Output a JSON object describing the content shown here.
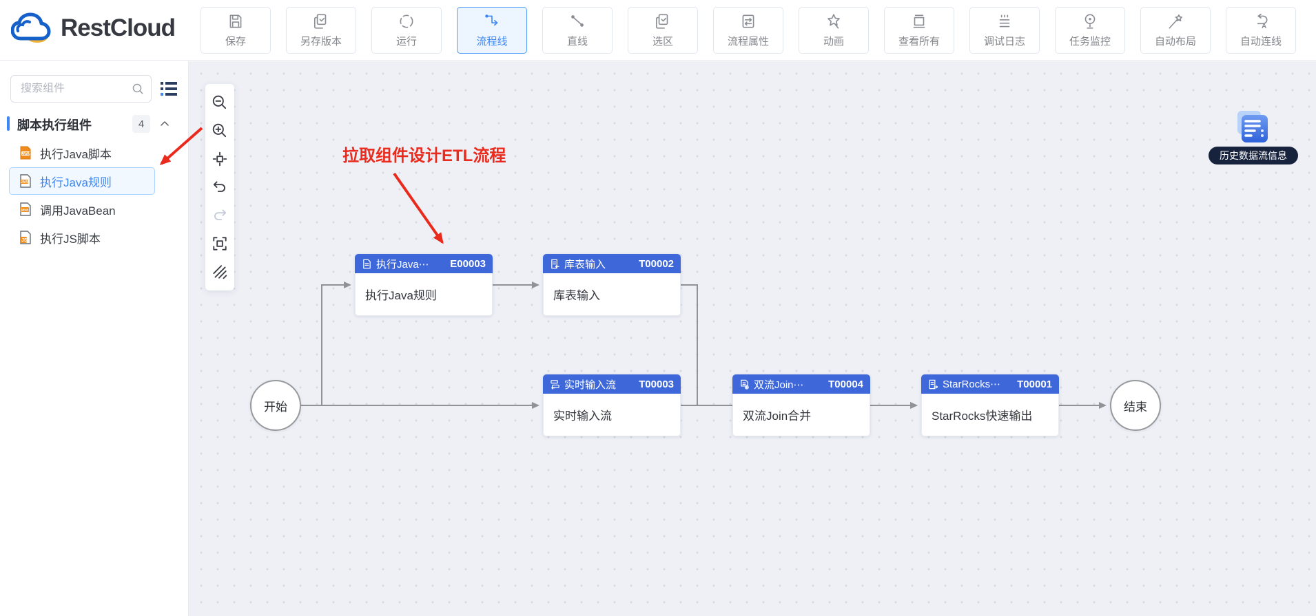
{
  "brand": {
    "name": "RestCloud"
  },
  "toolbar": {
    "buttons": [
      {
        "label": "保存",
        "icon": "save-icon",
        "active": false
      },
      {
        "label": "另存版本",
        "icon": "save-as-version-icon",
        "active": false
      },
      {
        "label": "运行",
        "icon": "run-icon",
        "active": false
      },
      {
        "label": "流程线",
        "icon": "flow-line-icon",
        "active": true
      },
      {
        "label": "直线",
        "icon": "straight-line-icon",
        "active": false
      },
      {
        "label": "选区",
        "icon": "selection-icon",
        "active": false
      },
      {
        "label": "流程属性",
        "icon": "flow-properties-icon",
        "active": false
      },
      {
        "label": "动画",
        "icon": "animation-icon",
        "active": false
      },
      {
        "label": "查看所有",
        "icon": "view-all-icon",
        "active": false
      },
      {
        "label": "调试日志",
        "icon": "debug-log-icon",
        "active": false
      },
      {
        "label": "任务监控",
        "icon": "task-monitor-icon",
        "active": false
      },
      {
        "label": "自动布局",
        "icon": "auto-layout-icon",
        "active": false
      },
      {
        "label": "自动连线",
        "icon": "auto-connect-icon",
        "active": false
      }
    ]
  },
  "sidebar": {
    "search_placeholder": "搜索组件",
    "section": {
      "title": "脚本执行组件",
      "count": "4"
    },
    "items": [
      {
        "label": "执行Java脚本",
        "icon": "java-script-doc-icon",
        "selected": false
      },
      {
        "label": "执行Java规则",
        "icon": "java-rule-doc-icon",
        "selected": true
      },
      {
        "label": "调用JavaBean",
        "icon": "javabean-doc-icon",
        "selected": false
      },
      {
        "label": "执行JS脚本",
        "icon": "js-doc-icon",
        "selected": false
      }
    ]
  },
  "palette": {
    "tools": [
      "zoom-out",
      "zoom-in",
      "fit-view",
      "undo",
      "redo",
      "fullscreen",
      "grid-toggle"
    ]
  },
  "canvas": {
    "annotation": "拉取组件设计ETL流程",
    "start_label": "开始",
    "end_label": "结束",
    "history_label": "历史数据流信息",
    "nodes": [
      {
        "title": "执行Java⋯",
        "code": "E00003",
        "body": "执行Java规则"
      },
      {
        "title": "库表输入",
        "code": "T00002",
        "body": "库表输入"
      },
      {
        "title": "实时输入流",
        "code": "T00003",
        "body": "实时输入流"
      },
      {
        "title": "双流Join⋯",
        "code": "T00004",
        "body": "双流Join合并"
      },
      {
        "title": "StarRocks⋯",
        "code": "T00001",
        "body": "StarRocks快速输出"
      }
    ]
  },
  "colors": {
    "accent": "#3d87f5",
    "node_header": "#3e68d9",
    "annotation_red": "#ea2a1c",
    "connector": "#8f9296",
    "canvas_bg": "#eef0f6"
  }
}
